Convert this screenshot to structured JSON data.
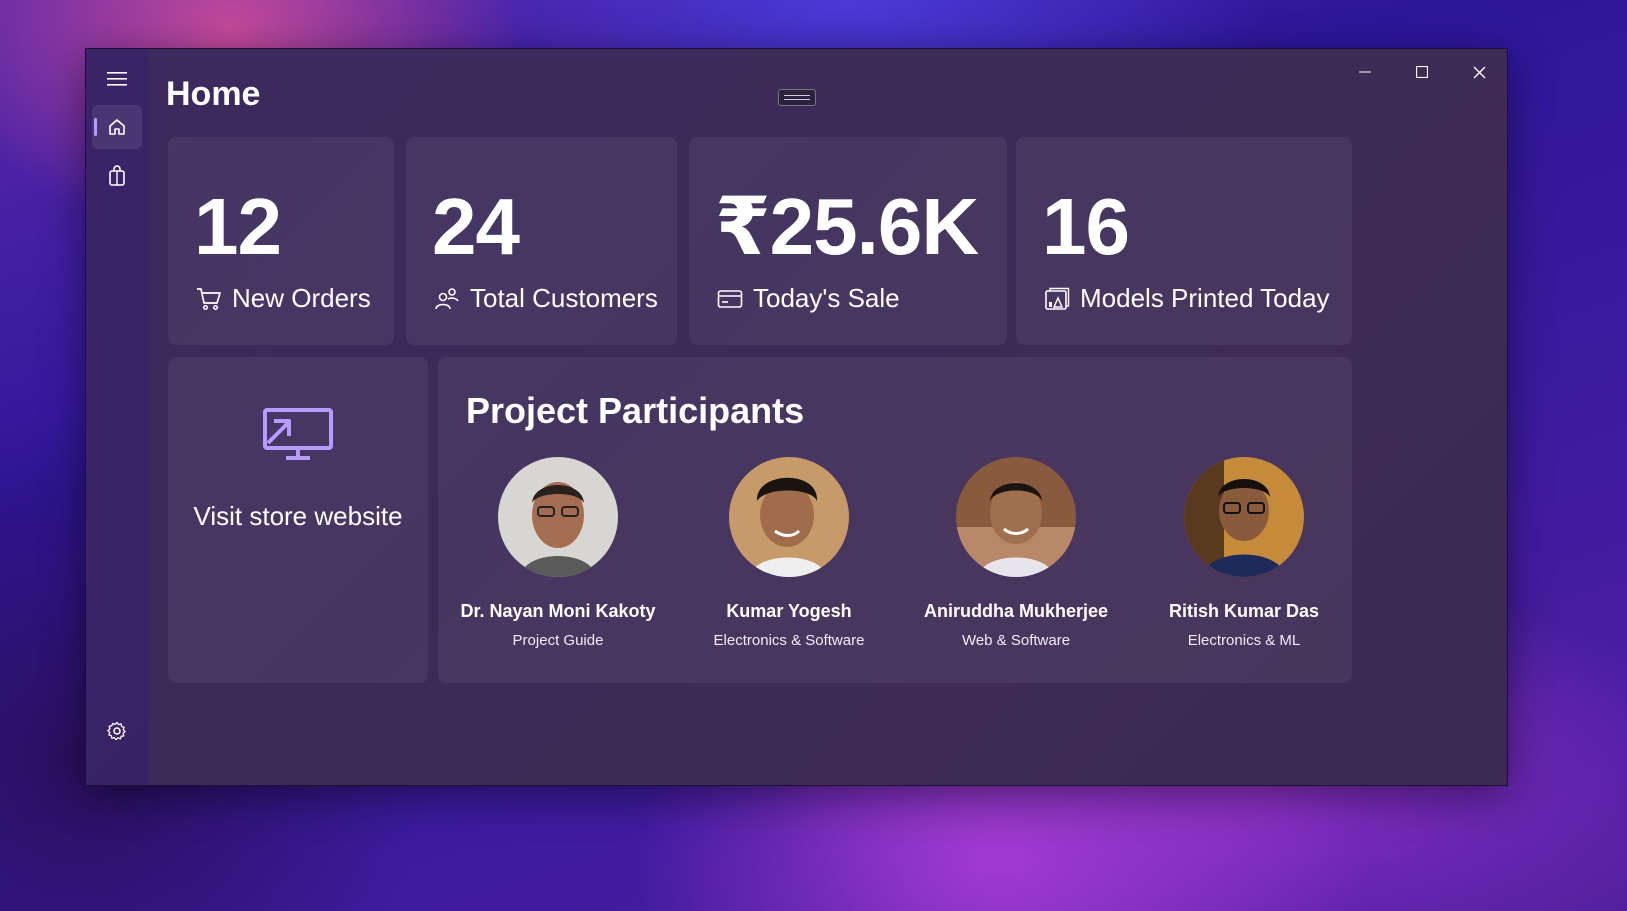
{
  "window": {
    "title": "Home"
  },
  "nav": {
    "items": [
      {
        "icon": "hamburger-menu-icon"
      },
      {
        "icon": "home-icon",
        "active": true
      },
      {
        "icon": "shopping-bag-icon"
      },
      {
        "icon": "settings-gear-icon"
      }
    ]
  },
  "stats": [
    {
      "value": "12",
      "label": "New Orders",
      "icon": "cart-icon"
    },
    {
      "value": "24",
      "label": "Total Customers",
      "icon": "people-icon"
    },
    {
      "value": "₹25.6K",
      "label": "Today's Sale",
      "icon": "credit-card-icon"
    },
    {
      "value": "16",
      "label": "Models Printed Today",
      "icon": "image-chart-icon"
    }
  ],
  "visit_card": {
    "label": "Visit store website",
    "icon": "monitor-share-icon"
  },
  "participants": {
    "title": "Project Participants",
    "people": [
      {
        "name": "Dr. Nayan Moni Kakoty",
        "role": "Project Guide"
      },
      {
        "name": "Kumar Yogesh",
        "role": "Electronics & Software"
      },
      {
        "name": "Aniruddha Mukherjee",
        "role": "Web & Software"
      },
      {
        "name": "Ritish Kumar Das",
        "role": "Electronics & ML"
      }
    ]
  },
  "colors": {
    "accent": "#b79cff",
    "window_bg": "#3c2b5a",
    "card_bg": "#4a3a66"
  }
}
